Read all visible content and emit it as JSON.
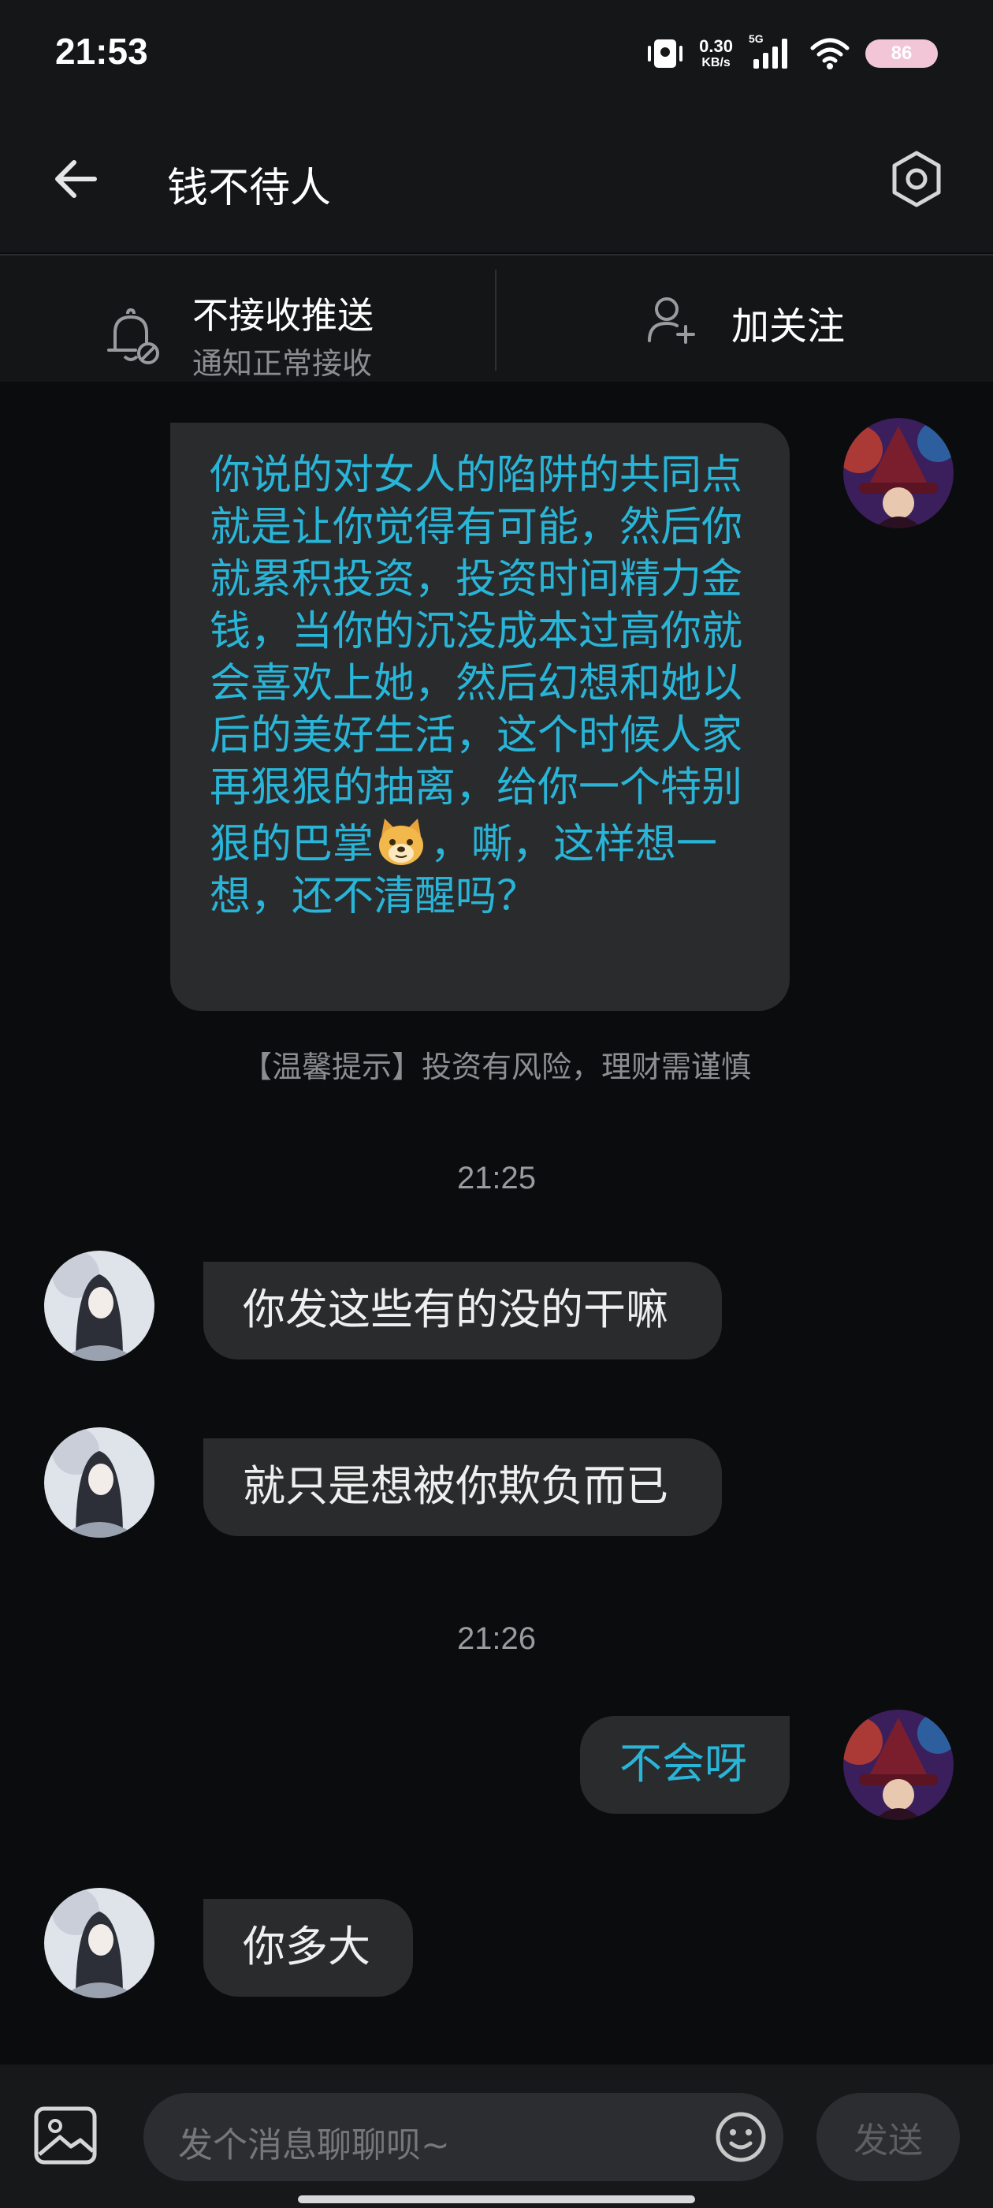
{
  "status_bar": {
    "time": "21:53",
    "net_speed_value": "0.30",
    "net_speed_unit": "KB/s",
    "signal_label": "5G",
    "battery_level": "86"
  },
  "header": {
    "title": "钱不待人"
  },
  "actions": {
    "mute_title": "不接收推送",
    "mute_subtitle": "通知正常接收",
    "follow_label": "加关注"
  },
  "messages": {
    "m1_text": "你说的对女人的陷阱的共同点就是让你觉得有可能，然后你就累积投资，投资时间精力金钱，当你的沉没成本过高你就会喜欢上她，然后幻想和她以后的美好生活，这个时候人家再狠狠的抽离，给你一个特别狠的巴掌",
    "m1_tail": "，嘶，这样想一想，还不清醒吗？",
    "tip": "【温馨提示】投资有风险，理财需谨慎",
    "ts1": "21:25",
    "m2_text": "你发这些有的没的干嘛",
    "m3_text": "就只是想被你欺负而已",
    "ts2": "21:26",
    "m4_text": "不会呀",
    "m5_text": "你多大"
  },
  "input": {
    "placeholder": "发个消息聊聊呗~",
    "send_label": "发送"
  },
  "colors": {
    "accent_text": "#29b5d8",
    "bubble_bg": "#2a2b2d",
    "background": "#0b0c0e"
  }
}
